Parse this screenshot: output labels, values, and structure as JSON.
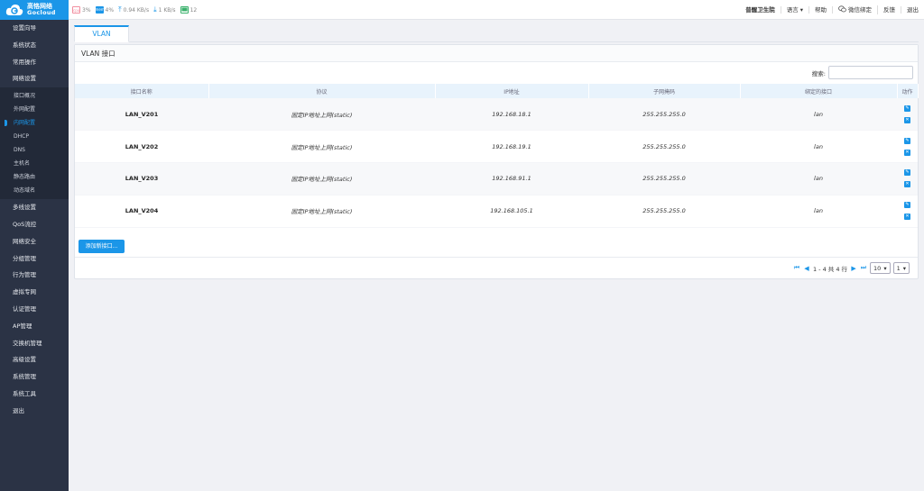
{
  "app": {
    "logo_cn": "高恪网络",
    "logo_en": "Gocloud"
  },
  "stats": {
    "cpu": "3%",
    "mem": "4%",
    "upload": "0.94 KB/s",
    "download": "1 KB/s",
    "connections": "12"
  },
  "topnav": {
    "site": "普醒卫生院",
    "language": "语言",
    "help": "帮助",
    "wechat": "微信绑定",
    "feedback": "反馈",
    "logout": "退出"
  },
  "sidebar": {
    "items_before": [
      "设置向导",
      "系统状态",
      "常用操作",
      "网络设置"
    ],
    "sub_items": [
      "接口概况",
      "外网配置",
      "内网配置",
      "DHCP",
      "DNS",
      "主机名",
      "静态路由",
      "动态域名"
    ],
    "active_sub": "内网配置",
    "items_after": [
      "多线设置",
      "QoS流控",
      "网络安全",
      "分组管理",
      "行为管理",
      "虚拟专网",
      "认证管理",
      "AP管理",
      "交换机管理",
      "高级设置",
      "系统管理",
      "系统工具",
      "退出"
    ]
  },
  "tabs": [
    {
      "label": "VLAN"
    }
  ],
  "panel": {
    "title": "VLAN 接口",
    "search_label": "搜索:",
    "search_value": "",
    "add_button": "添加新接口..."
  },
  "table": {
    "headers": [
      "接口名称",
      "协议",
      "IP地址",
      "子网掩码",
      "绑定的接口",
      "动作"
    ],
    "rows": [
      {
        "name": "LAN_V201",
        "protocol": "固定IP地址上网(static)",
        "ip": "192.168.18.1",
        "mask": "255.255.255.0",
        "bind": "lan"
      },
      {
        "name": "LAN_V202",
        "protocol": "固定IP地址上网(static)",
        "ip": "192.168.19.1",
        "mask": "255.255.255.0",
        "bind": "lan"
      },
      {
        "name": "LAN_V203",
        "protocol": "固定IP地址上网(static)",
        "ip": "192.168.91.1",
        "mask": "255.255.255.0",
        "bind": "lan"
      },
      {
        "name": "LAN_V204",
        "protocol": "固定IP地址上网(static)",
        "ip": "192.168.105.1",
        "mask": "255.255.255.0",
        "bind": "lan"
      }
    ]
  },
  "pager": {
    "summary": "1 - 4 共 4 行",
    "page_size": "10",
    "page": "1"
  },
  "colors": {
    "accent": "#1b96e8",
    "sidebar": "#2b3345",
    "submenu": "#222938"
  }
}
